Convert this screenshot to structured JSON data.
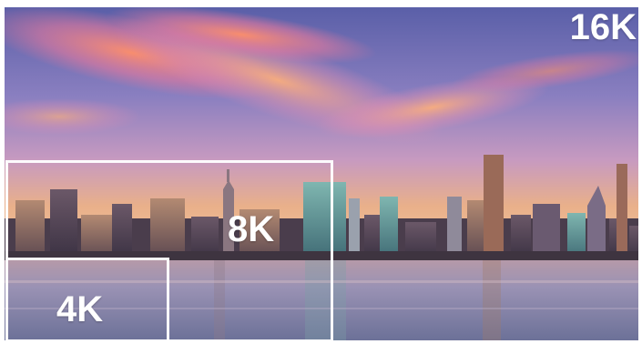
{
  "image": {
    "labels": {
      "res_16k": "16K",
      "res_8k": "8K",
      "res_4k": "4K"
    },
    "colors": {
      "label_text": "#ffffff",
      "box_outline": "#ffffff",
      "sky_top": "#5a5fa8",
      "sky_glow": "#f08a8a",
      "horizon": "#e9b08a",
      "water": "#7f86a8"
    }
  }
}
